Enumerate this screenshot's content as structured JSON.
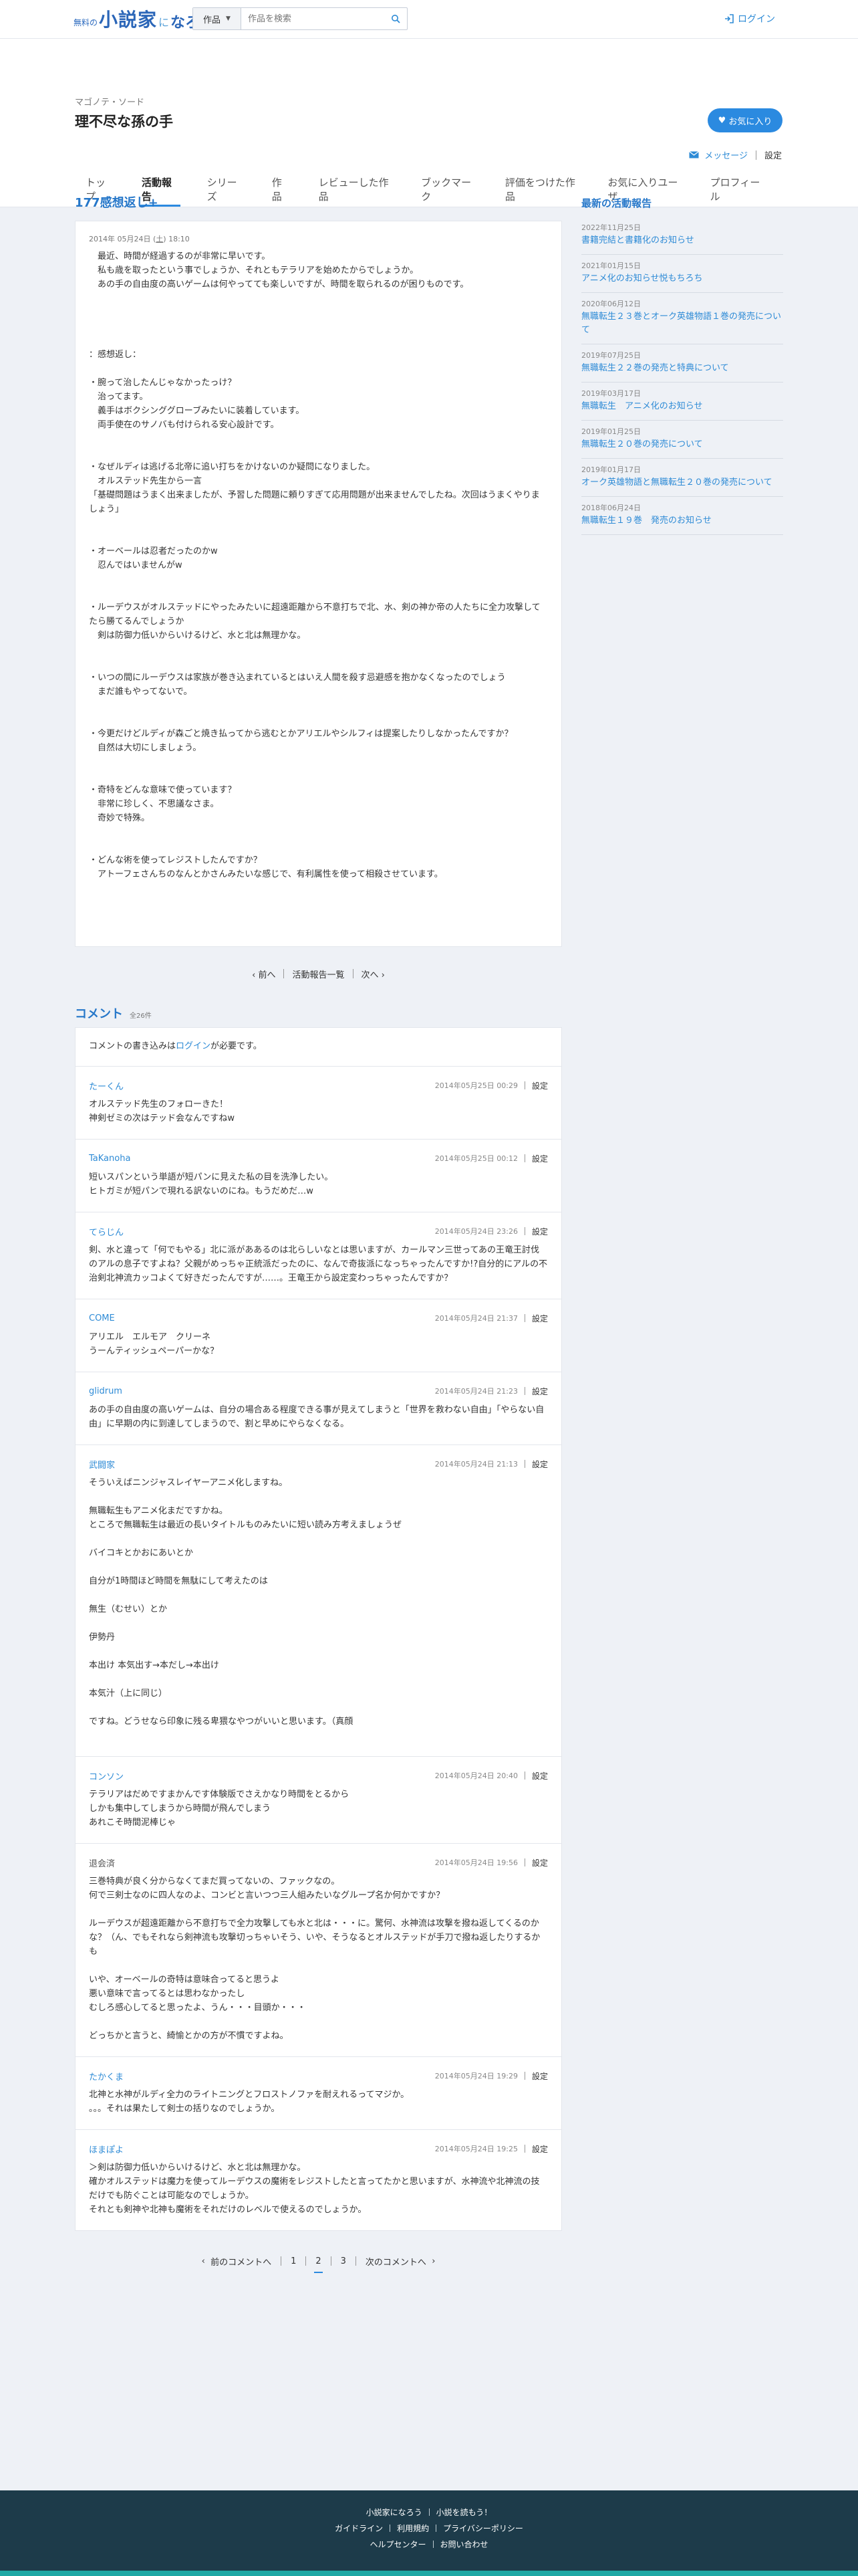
{
  "header": {
    "logo": {
      "prefix": "無料の",
      "main1": "小説家",
      "mid": "に",
      "main2": "なろう"
    },
    "search": {
      "category": "作品",
      "placeholder": "作品を検索"
    },
    "login_label": "ログイン"
  },
  "user": {
    "reading": "マゴノテ・ソード",
    "name": "理不尽な孫の手",
    "favorite_button": "お気に入り",
    "message_link": "メッセージ",
    "settings_link": "設定"
  },
  "tabs": [
    {
      "label": "トップ",
      "active": false
    },
    {
      "label": "活動報告",
      "active": true
    },
    {
      "label": "シリーズ",
      "active": false
    },
    {
      "label": "作品",
      "active": false
    },
    {
      "label": "レビューした作品",
      "active": false
    },
    {
      "label": "ブックマーク",
      "active": false
    },
    {
      "label": "評価をつけた作品",
      "active": false
    },
    {
      "label": "お気に入りユーザ",
      "active": false
    },
    {
      "label": "プロフィール",
      "active": false
    }
  ],
  "post": {
    "title": "177感想返し+",
    "date_prefix": "2014年 05月24日 (",
    "date_day": "土",
    "date_suffix": ") 18:10",
    "body": "　最近、時間が経過するのが非常に早いです。\n　私も歳を取ったという事でしょうか、それともテラリアを始めたからでしょうか。\n　あの手の自由度の高いゲームは何やってても楽しいですが、時間を取られるのが困りものです。\n\n\n\n\n：感想返し：\n\n・腕って治したんじゃなかったっけ？\n　治ってます。\n　義手はボクシンググローブみたいに装着しています。\n　両手使在のサノバも付けられる安心設計です。\n\n\n・なぜルディは逃げる北帝に追い打ちをかけないのか疑問になりました。\n　オルステッド先生から一言\n「基礎問題はうまく出来ましたが、予習した問題に頼りすぎて応用問題が出来ませんでしたね。次回はうまくやりましょう」\n\n\n・オーベールは忍者だったのかw\n　忍んではいませんがw\n\n\n・ルーデウスがオルステッドにやったみたいに超遠距離から不意打ちで北、水、剣の神か帝の人たちに全力攻撃してたら勝てるんでしょうか\n　剣は防御力低いからいけるけど、水と北は無理かな。\n\n\n・いつの間にルーデウスは家族が巻き込まれているとはいえ人間を殺す忌避感を抱かなくなったのでしょう\n　まだ誰もやってないで。\n\n\n・今更だけどルディが森ごと焼き払ってから逃むとかアリエルやシルフィは提案したりしなかったんですか？\n　自然は大切にしましょう。\n\n\n・奇特をどんな意味で使っています？\n　非常に珍しく、不思議なさま。\n　奇妙で特殊。\n\n\n・どんな術を使ってレジストしたんですか？\n　アトーフェさんちのなんとかさんみたいな感じで、有利属性を使って相殺させています。"
  },
  "post_pager": {
    "prev": "前へ",
    "list": "活動報告一覧",
    "next": "次へ"
  },
  "comments": {
    "title": "コメント",
    "count": "全26件",
    "notice_pre": "コメントの書き込みは",
    "notice_link": "ログイン",
    "notice_post": "が必要です。",
    "settings_label": "設定",
    "items": [
      {
        "author": "たーくん",
        "linked": true,
        "date": "2014年05月25日 00:29",
        "body": "オルステッド先生のフォローきた！\n神剣ゼミの次はテッド会なんですねw"
      },
      {
        "author": "TaKanoha",
        "linked": true,
        "date": "2014年05月25日 00:12",
        "body": "短いスパンという単語が短パンに見えた私の目を洗浄したい。\nヒトガミが短パンで現れる訳ないのにね。もうだめだ…w"
      },
      {
        "author": "てらじん",
        "linked": true,
        "date": "2014年05月24日 23:26",
        "body": "剣、水と違って「何でもやる」北に派がああるのは北らしいなとは思いますが、カールマン三世ってあの王竜王討伐のアルの息子ですよね？父親がめっちゃ正統派だったのに、なんで奇抜派になっちゃったんですか!?自分的にアルの不治剣北神流カッコよくて好きだったんですが……。王竜王から設定変わっちゃったんですか？"
      },
      {
        "author": "COME",
        "linked": true,
        "date": "2014年05月24日 21:37",
        "body": "アリエル　エルモア　クリーネ\nうーんティッシュペーパーかな？"
      },
      {
        "author": "glidrum",
        "linked": true,
        "date": "2014年05月24日 21:23",
        "body": "あの手の自由度の高いゲームは、自分の場合ある程度できる事が見えてしまうと「世界を救わない自由」「やらない自由」に早期の内に到達してしまうので、割と早めにやらなくなる。"
      },
      {
        "author": "武闘家",
        "linked": true,
        "date": "2014年05月24日 21:13",
        "body": "そういえばニンジャスレイヤーアニメ化しますね。\n\n無職転生もアニメ化まだですかね。\nところで無職転生は最近の長いタイトルものみたいに短い読み方考えましょうぜ\n\nバイコキとかおにあいとか\n\n自分が1時間ほど時間を無駄にして考えたのは\n\n無生（むせい）とか\n\n伊勢丹\n\n本出け 本気出す→本だし→本出け\n\n本気汁（上に同じ）\n\nですね。どうせなら印象に残る卑猥なやつがいいと思います。（真顔\n\n"
      },
      {
        "author": "コンソン",
        "linked": true,
        "date": "2014年05月24日 20:40",
        "body": "テラリアはだめですまかんです体験版でさえかなり時間をとるから\nしかも集中してしまうから時間が飛んでしまう\nあれこそ時間泥棒じゃ"
      },
      {
        "author": "退会済",
        "linked": false,
        "date": "2014年05月24日 19:56",
        "body": "三巻特典が良く分からなくてまだ買ってないの、ファックなの。\n何で三剣士なのに四人なのよ、コンビと言いつつ三人組みたいなグループ名か何かですか？\n\nルーデウスが超遠距離から不意打ちで全力攻撃しても水と北は・・・に。驚何、水神流は攻撃を撥ね返してくるのかな？（ん、でもそれなら剣神流も攻撃切っちゃいそう、いや、そうなるとオルステッドが手刀で撥ね返したりするかも\n\nいや、オーベールの奇特は意味合ってると思うよ\n悪い意味で言ってるとは思わなかったし\nむしろ感心してると思ったよ、うん・・・目頭か・・・\n\nどっちかと言うと、綺愉とかの方が不慣ですよね。"
      },
      {
        "author": "たかくま",
        "linked": true,
        "date": "2014年05月24日 19:29",
        "body": "北神と水神がルディ全力のライトニングとフロストノファを耐えれるってマジか。\n。。。それは果たして剣士の括りなのでしょうか。"
      },
      {
        "author": "ほまぽよ",
        "linked": true,
        "date": "2014年05月24日 19:25",
        "body": "＞剣は防御力低いからいけるけど、水と北は無理かな。\n確かオルステッドは魔力を使ってルーデウスの魔術をレジストしたと言ってたかと思いますが、水神流や北神流の技だけでも防ぐことは可能なのでしょうか。\nそれとも剣神や北神も魔術をそれだけのレベルで使えるのでしょうか。"
      }
    ]
  },
  "comment_pager": {
    "prev": "前のコメントへ",
    "pages": [
      "1",
      "2",
      "3"
    ],
    "current": "2",
    "next": "次のコメントへ"
  },
  "sidebar": {
    "title": "最新の活動報告",
    "items": [
      {
        "date": "2022年11月25日",
        "title": "書籍完結と書籍化のお知らせ"
      },
      {
        "date": "2021年01月15日",
        "title": "アニメ化のお知らせ悦もちろち"
      },
      {
        "date": "2020年06月12日",
        "title": "無職転生２３巻とオーク英雄物語１巻の発売について"
      },
      {
        "date": "2019年07月25日",
        "title": "無職転生２２巻の発売と特典について"
      },
      {
        "date": "2019年03月17日",
        "title": "無職転生　アニメ化のお知らせ"
      },
      {
        "date": "2019年01月25日",
        "title": "無職転生２０巻の発売について"
      },
      {
        "date": "2019年01月17日",
        "title": "オーク英雄物語と無職転生２０巻の発売について"
      },
      {
        "date": "2018年06月24日",
        "title": "無職転生１９巻　発売のお知らせ"
      }
    ]
  },
  "footer": {
    "row1": [
      "小説家になろう",
      "小説を読もう！"
    ],
    "row2": [
      "ガイドライン",
      "利用規約",
      "プライバシーポリシー"
    ],
    "row3": [
      "ヘルプセンター",
      "お問い合わせ"
    ]
  },
  "colors": {
    "accent": "#2b8ae0",
    "link": "#2e8bd6",
    "title": "#2677c9",
    "footer": "#1d3b4a"
  }
}
